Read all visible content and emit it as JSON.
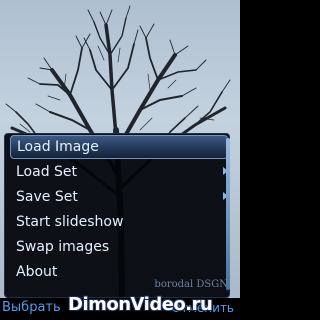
{
  "menu": {
    "items": [
      {
        "label": "Load Image",
        "selected": true,
        "has_submenu": false
      },
      {
        "label": "Load Set",
        "selected": false,
        "has_submenu": true
      },
      {
        "label": "Save Set",
        "selected": false,
        "has_submenu": true
      },
      {
        "label": "Start slideshow",
        "selected": false,
        "has_submenu": false
      },
      {
        "label": "Swap images",
        "selected": false,
        "has_submenu": false
      },
      {
        "label": "About",
        "selected": false,
        "has_submenu": false
      }
    ]
  },
  "credit": "borodal DSGN",
  "softkeys": {
    "left": "Выбрать",
    "right": "Отменить"
  },
  "watermark": "DimonVideo.ru",
  "colors": {
    "accent": "#4f9cf0",
    "menu_text": "#e3f1ff",
    "highlight": "#2f4a70",
    "sky": "#b9c9d8"
  },
  "icons": {
    "submenu": "chevron-right-icon",
    "wallpaper": "bare-tree-wallpaper"
  }
}
